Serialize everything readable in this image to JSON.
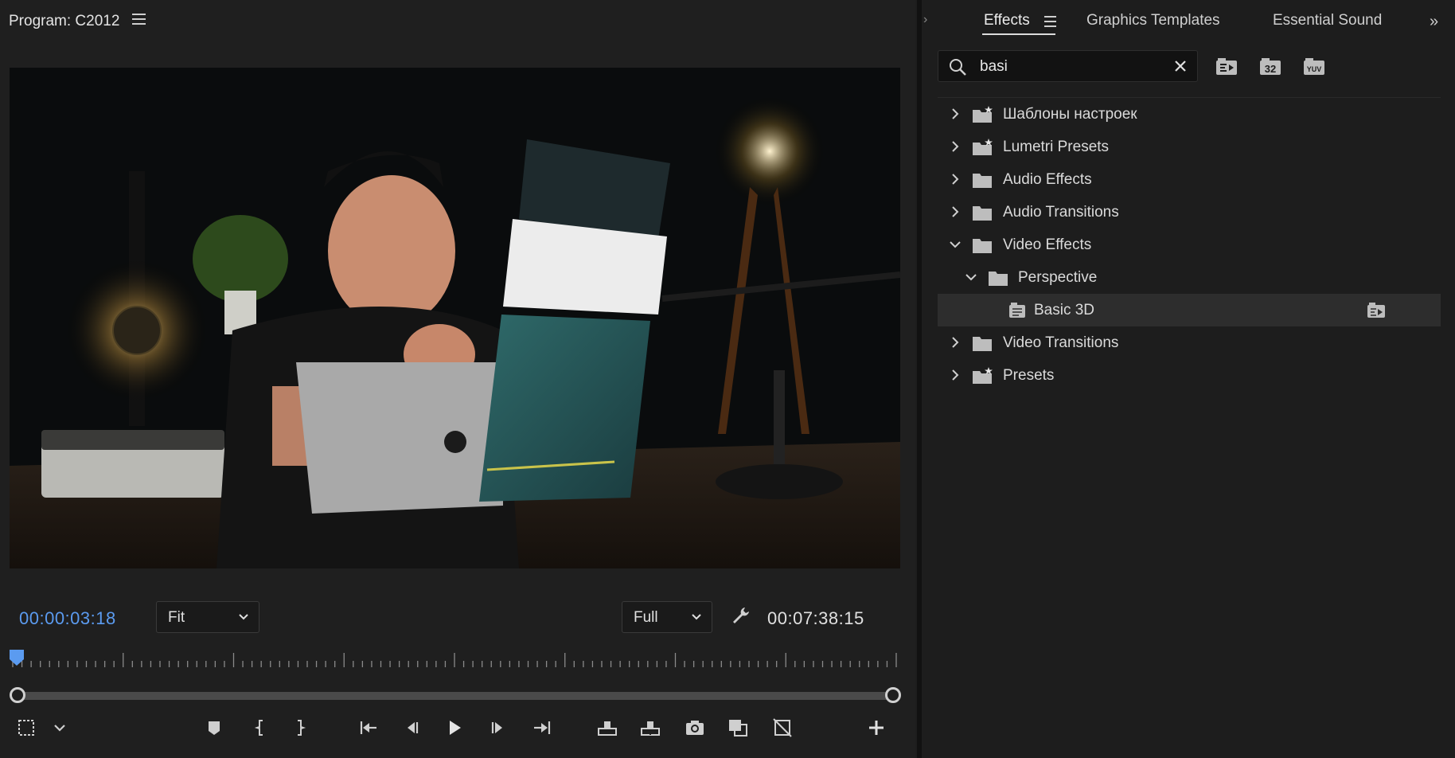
{
  "program_monitor": {
    "title": "Program: C2012",
    "current_timecode": "00:00:03:18",
    "duration_timecode": "00:07:38:15",
    "zoom_select": "Fit",
    "resolution_select": "Full",
    "menu_icon": "hamburger-icon"
  },
  "transport": {
    "buttons": [
      "settings-icon",
      "chevron-down-icon",
      "add-marker-icon",
      "mark-in-icon",
      "mark-out-icon",
      "go-to-in-icon",
      "step-back-icon",
      "play-icon",
      "step-forward-icon",
      "go-to-out-icon",
      "lift-icon",
      "extract-icon",
      "export-frame-icon",
      "comparison-view-icon",
      "toggle-proxies-icon",
      "add-button-icon"
    ]
  },
  "effects_panel": {
    "tabs": [
      "Effects",
      "Graphics Templates",
      "Essential Sound"
    ],
    "active_tab": "Effects",
    "search": {
      "value": "basi",
      "placeholder": ""
    },
    "filter_icons": [
      "accelerated-effects-icon",
      "32-bit-icon",
      "yuv-icon"
    ],
    "filter_labels": {
      "bit32": "32",
      "yuv": "YUV"
    },
    "tree": [
      {
        "label": "Шаблоны настроек",
        "expanded": false,
        "icon": "preset-folder-icon"
      },
      {
        "label": "Lumetri Presets",
        "expanded": false,
        "icon": "preset-folder-icon"
      },
      {
        "label": "Audio Effects",
        "expanded": false,
        "icon": "folder-icon"
      },
      {
        "label": "Audio Transitions",
        "expanded": false,
        "icon": "folder-icon"
      },
      {
        "label": "Video Effects",
        "expanded": true,
        "icon": "folder-icon"
      },
      {
        "label": "Perspective",
        "expanded": true,
        "icon": "folder-icon"
      },
      {
        "label": "Basic 3D",
        "selected": true,
        "icon": "effect-icon"
      },
      {
        "label": "Video Transitions",
        "expanded": false,
        "icon": "folder-icon"
      },
      {
        "label": "Presets",
        "expanded": false,
        "icon": "preset-folder-icon"
      }
    ]
  },
  "colors": {
    "accent_blue": "#5b9bf0",
    "panel_bg": "#1d1d1d",
    "selected_row": "#2d2d2d"
  }
}
